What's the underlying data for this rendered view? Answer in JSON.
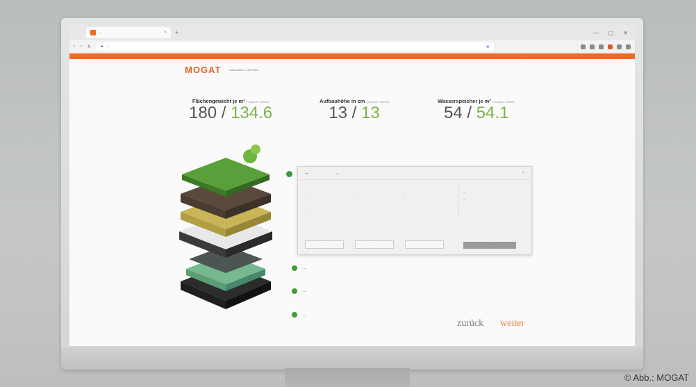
{
  "browser": {
    "tab_label": "...",
    "new_tab_symbol": "+",
    "url": "...",
    "window_controls": [
      "—",
      "▢",
      "✕"
    ]
  },
  "header": {
    "logo": "MOGAT",
    "breadcrumb": "Dachaufbau › Übersicht",
    "top_links": "..."
  },
  "stats": [
    {
      "label": "Flächengewicht je m²",
      "note": "(Vorgabe / aktuell)",
      "target": "180",
      "current": "134.6"
    },
    {
      "label": "Aufbauhöhe in cm",
      "note": "(Vorgabe / aktuell)",
      "target": "13",
      "current": "13"
    },
    {
      "label": "Wasserspeicher je m²",
      "note": "(Vorgabe / aktuell)",
      "target": "54",
      "current": "54.1"
    }
  ],
  "dialog": {
    "title": "...",
    "subtitle": "...",
    "columns": [
      [
        "...",
        "...",
        "...",
        "...",
        "...",
        "..."
      ],
      [
        "...",
        "...",
        "...",
        "...",
        "..."
      ],
      [
        "...",
        "...",
        "...",
        "...",
        "..."
      ]
    ],
    "right_title": "...",
    "right_items": [
      "...",
      "...",
      "..."
    ],
    "buttons": [
      "...",
      "...",
      "..."
    ],
    "confirm": "...",
    "close": "×"
  },
  "steps": [
    {
      "label": "...",
      "sub": "..."
    },
    {
      "label": "...",
      "sub": "..."
    },
    {
      "label": "...",
      "sub": ""
    }
  ],
  "nav": {
    "back": "zurück",
    "next": "weiter"
  },
  "copyright": "© Abb.: MOGAT",
  "colors": {
    "accent": "#f26a21",
    "green": "#7ab24a",
    "dot": "#3e9a3e"
  }
}
